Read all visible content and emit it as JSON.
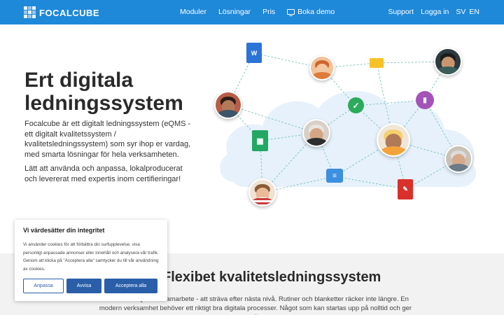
{
  "header": {
    "logo_text": "FOCALCUBE",
    "nav_left": [
      "Moduler",
      "Lösningar",
      "Pris",
      "Boka demo"
    ],
    "nav_right": [
      "Support",
      "Logga in",
      "SV",
      "EN"
    ]
  },
  "hero": {
    "title": "Ert digitala ledningssystem",
    "paragraph1": "Focalcube är ett digitalt ledningssystem (eQMS - ett digitalt kvalitetssystem / kvalitetsledningssystem) som syr ihop er vardag, med smarta lösningar för hela verksamheten.",
    "paragraph2": "Lätt att använda och anpassa, lokalproducerat och levererat med expertis inom certifieringar!"
  },
  "cookie_banner": {
    "title": "Vi värdesätter din integritet",
    "text": "Vi använder cookies för att förbättra din surfupplevelse, visa personligt anpassade annonser eller innehåll och analysera vår trafik. Genom att klicka på \"Acceptera alla\" samtycker du till vår användning av cookies.",
    "customize_label": "Anpassa",
    "reject_label": "Avvisa",
    "accept_label": "Acceptera alla"
  },
  "section2": {
    "title": "Flexibet kvalitetsledningssystem",
    "text": "Arbetet i ett QMS är samarbete - att sträva efter nästa nivå. Rutiner och blanketter räcker inte längre. En modern verksamhet behöver ett riktigt bra digitala processer. Något som kan startas upp på nolltid och ger alla"
  },
  "colors": {
    "header_bg": "#1e88d9",
    "button_primary": "#2a5ea8",
    "cloud": "#e6f1fb"
  },
  "icons": [
    "word-doc-icon",
    "sheet-icon",
    "check-icon",
    "chat-icon",
    "pdf-icon",
    "ticket-icon",
    "chart-icon",
    "monitor-icon"
  ]
}
